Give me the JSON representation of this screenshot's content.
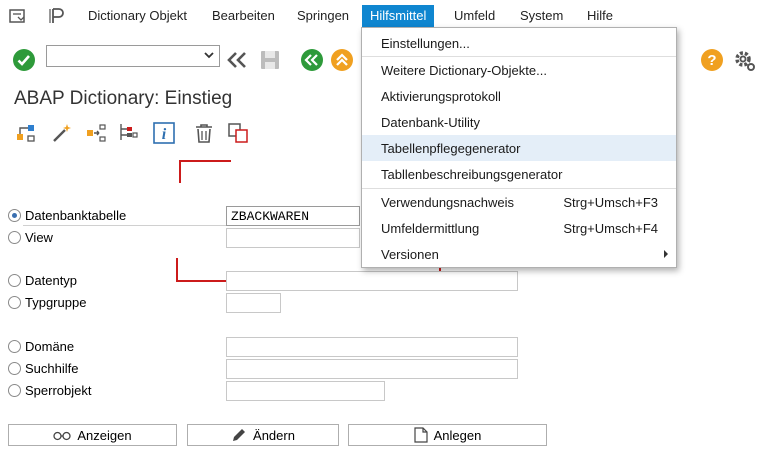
{
  "menubar": {
    "items": [
      "Dictionary Objekt",
      "Bearbeiten",
      "Springen",
      "Hilfsmittel",
      "Umfeld",
      "System",
      "Hilfe"
    ],
    "active": "Hilfsmittel"
  },
  "toolbar": {
    "command_value": "",
    "icons": [
      "check-icon",
      "back-double-chevron-icon",
      "save-icon",
      "back-icon",
      "up-icon",
      "help-icon",
      "settings-gear-icon"
    ]
  },
  "page": {
    "title": "ABAP Dictionary: Einstieg"
  },
  "app_toolbar": {
    "icons": [
      "hierarchy-icon",
      "magic-wand-icon",
      "where-used-icon",
      "object-list-icon",
      "info-icon",
      "delete-icon",
      "copy-icon"
    ]
  },
  "form": {
    "rows": [
      {
        "label": "Datenbanktabelle",
        "value": "ZBACKWAREN",
        "selected": true
      },
      {
        "label": "View",
        "value": "",
        "selected": false
      },
      {
        "label": "Datentyp",
        "value": "",
        "selected": false
      },
      {
        "label": "Typgruppe",
        "value": "",
        "selected": false
      },
      {
        "label": "Domäne",
        "value": "",
        "selected": false
      },
      {
        "label": "Suchhilfe",
        "value": "",
        "selected": false
      },
      {
        "label": "Sperrobjekt",
        "value": "",
        "selected": false
      }
    ]
  },
  "buttons": {
    "anzeigen": "Anzeigen",
    "aendern": "Ändern",
    "anlegen": "Anlegen"
  },
  "dropdown": {
    "items": [
      {
        "label": "Einstellungen...",
        "shortcut": ""
      },
      {
        "label": "Weitere Dictionary-Objekte...",
        "shortcut": ""
      },
      {
        "label": "Aktivierungsprotokoll",
        "shortcut": ""
      },
      {
        "label": "Datenbank-Utility",
        "shortcut": ""
      },
      {
        "label": "Tabellenpflegegenerator",
        "shortcut": "",
        "highlighted": true
      },
      {
        "label": "Tabllenbeschreibungsgenerator",
        "shortcut": ""
      },
      {
        "label": "Verwendungsnachweis",
        "shortcut": "Strg+Umsch+F3"
      },
      {
        "label": "Umfeldermittlung",
        "shortcut": "Strg+Umsch+F4"
      },
      {
        "label": "Versionen",
        "shortcut": "",
        "submenu": true
      }
    ]
  },
  "colors": {
    "active_menu": "#0f86d0",
    "check_green": "#2e9a3a",
    "nav_orange": "#f0a020",
    "highlight": "#e4eef8",
    "annotation_red": "#cc1b1b"
  }
}
